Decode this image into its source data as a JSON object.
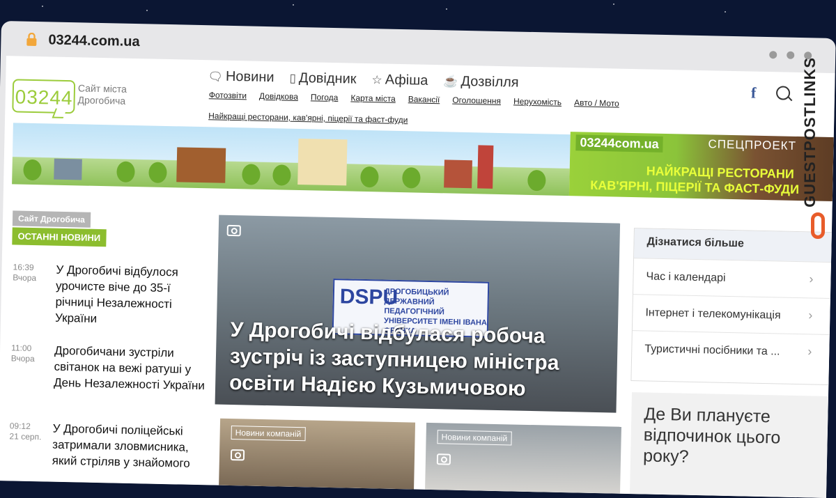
{
  "browser": {
    "url": "03244.com.ua"
  },
  "logo": {
    "number": "03244",
    "subtitle": "Сайт міста Дрогобича"
  },
  "main_nav": [
    {
      "label": "Новини",
      "icon": "speech-bubble-icon"
    },
    {
      "label": "Довідник",
      "icon": "book-icon"
    },
    {
      "label": "Афіша",
      "icon": "star-icon"
    },
    {
      "label": "Дозвілля",
      "icon": "cup-icon"
    }
  ],
  "sub_nav": [
    "Фотозвіти",
    "Довідкова",
    "Погода",
    "Карта міста",
    "Вакансії",
    "Оголошення",
    "Нерухомість",
    "Авто / Мото",
    "Найкращі ресторани, кав'ярні, піцерії та фаст-фуди"
  ],
  "header_icons": {
    "facebook": "f"
  },
  "special_banner": {
    "logo": "03244com.ua",
    "tag": "СПЕЦПРОЕКТ",
    "line1": "НАЙКРАЩІ РЕСТОРАНИ",
    "line2": "КАВ'ЯРНІ, ПІЦЕРІЇ ТА ФАСТ-ФУДИ"
  },
  "news_section": {
    "site_label": "Сайт Дрогобича",
    "heading": "ОСТАННІ НОВИНИ"
  },
  "news": [
    {
      "time": "16:39",
      "date": "Вчора",
      "title": "У Дрогобичі відбулося урочисте віче до 35-ї річниці Незалежності України"
    },
    {
      "time": "11:00",
      "date": "Вчора",
      "title": "Дрогобичани зустріли світанок на вежі ратуші у День Незалежності України"
    },
    {
      "time": "09:12",
      "date": "21 серп.",
      "title": "У Дрогобичі поліцейські затримали зловмисника, який стріляв у знайомого"
    }
  ],
  "hero": {
    "title": "У Дрогобичі відбулася робоча зустріч із заступницею міністра освіти Надією Кузьмичовою",
    "sign_abbr": "DSPU",
    "sign_text": "ДРОГОБИЦЬКИЙ ДЕРЖАВНИЙ ПЕДАГОГІЧНИЙ УНІВЕРСИТЕТ ІМЕНІ ІВАНА ФРАНКА"
  },
  "cards": [
    {
      "label": "Новини компаній"
    },
    {
      "label": "Новини компаній"
    }
  ],
  "sidebar": {
    "heading": "Дізнатися більше",
    "items": [
      "Час і календарі",
      "Інтернет і телекомунікація",
      "Туристичні посібники та ..."
    ]
  },
  "poll": {
    "question": "Де Ви плануєте відпочинок цього року?"
  },
  "watermark": {
    "text": "GUESTPOSTLINKS"
  }
}
